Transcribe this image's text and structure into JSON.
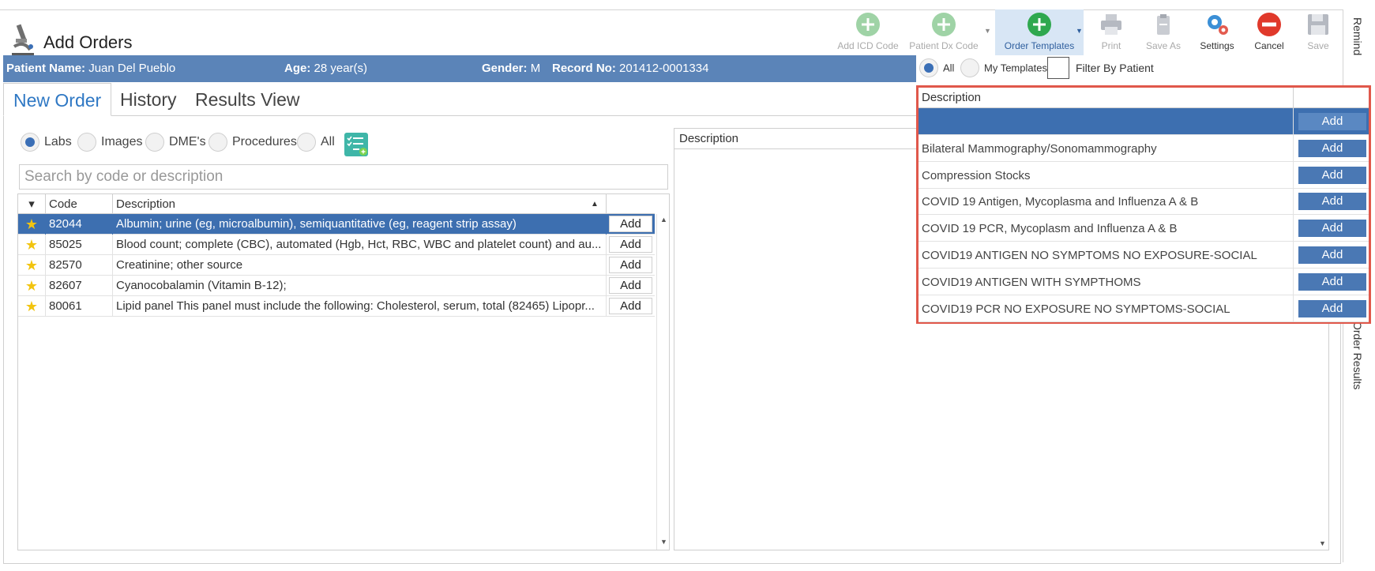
{
  "app": {
    "title": "Add Orders"
  },
  "toolbar": {
    "add_icd_code": "Add ICD Code",
    "patient_dx_code": "Patient Dx Code",
    "order_templates": "Order Templates",
    "print": "Print",
    "save_as": "Save As",
    "settings": "Settings",
    "cancel": "Cancel",
    "save": "Save"
  },
  "side_panel": {
    "reminders": "Remind",
    "order_results": "Order Results"
  },
  "patient": {
    "name_label": "Patient Name:",
    "name": "Juan Del Pueblo",
    "age_label": "Age:",
    "age": "28 year(s)",
    "gender_label": "Gender:",
    "gender": "M",
    "record_label": "Record No:",
    "record": "201412-0001334"
  },
  "tabs": {
    "new_order": "New Order",
    "history": "History",
    "results_view": "Results View"
  },
  "filters": {
    "labs": "Labs",
    "images": "Images",
    "dmes": "DME's",
    "procedures": "Procedures",
    "all": "All",
    "selected": "Labs"
  },
  "search": {
    "placeholder": "Search by code or description"
  },
  "orders_grid": {
    "headers": {
      "code": "Code",
      "description": "Description"
    },
    "add_label": "Add",
    "rows": [
      {
        "code": "82044",
        "description": "Albumin; urine (eg, microalbumin), semiquantitative (eg, reagent strip assay)"
      },
      {
        "code": "85025",
        "description": "Blood count; complete (CBC), automated (Hgb, Hct, RBC, WBC and platelet count) and au..."
      },
      {
        "code": "82570",
        "description": "Creatinine; other source"
      },
      {
        "code": "82607",
        "description": "Cyanocobalamin (Vitamin B-12);"
      },
      {
        "code": "80061",
        "description": "Lipid panel This panel must include the following: Cholesterol, serum, total (82465) Lipopr..."
      }
    ]
  },
  "right_panel": {
    "description_header": "Description"
  },
  "templates": {
    "all": "All",
    "my_templates": "My Templates",
    "filter_by_patient": "Filter By Patient",
    "description_header": "Description",
    "add_label": "Add",
    "rows": [
      "",
      "Bilateral Mammography/Sonomammography",
      "Compression Stocks",
      "COVID 19 Antigen, Mycoplasma and Influenza A & B",
      "COVID 19 PCR, Mycoplasm and Influenza A & B",
      "COVID19 ANTIGEN NO SYMPTOMS NO EXPOSURE-SOCIAL",
      "COVID19 ANTIGEN WITH SYMPTHOMS",
      "COVID19 PCR NO EXPOSURE NO SYMPTOMS-SOCIAL"
    ]
  },
  "colors": {
    "accent": "#3d6fb0",
    "patient_bar": "#5b84b8",
    "highlight_border": "#e0584b",
    "star": "#f2c40f"
  }
}
